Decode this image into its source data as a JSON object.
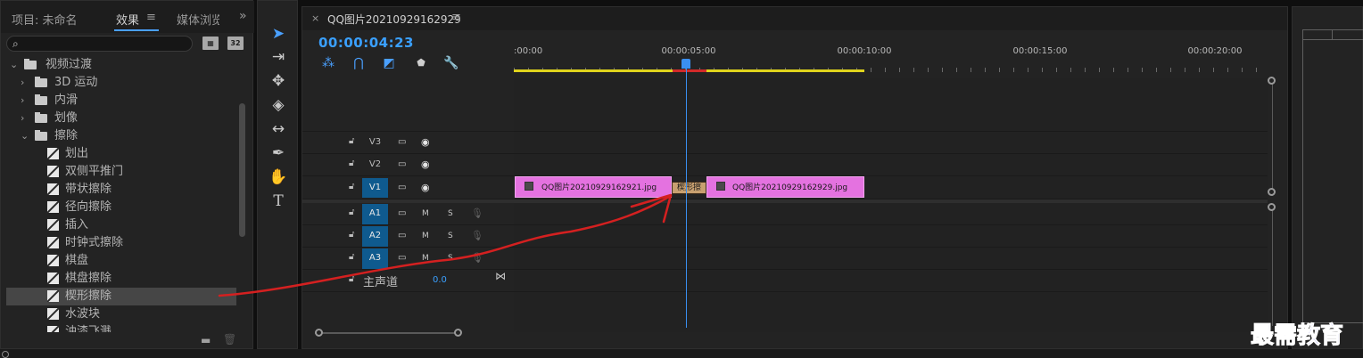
{
  "left_panel": {
    "tabs": [
      {
        "label": "项目: 未命名"
      },
      {
        "label": "效果"
      },
      {
        "label": "媒体浏览"
      }
    ],
    "menu_icon": "≡",
    "overflow_icon": "»",
    "badges": [
      "32",
      "32"
    ],
    "tree": [
      {
        "label": "视频过渡",
        "kind": "folder",
        "expanded": true
      },
      {
        "label": "3D 运动",
        "kind": "folder",
        "expanded": false
      },
      {
        "label": "内滑",
        "kind": "folder",
        "expanded": false
      },
      {
        "label": "划像",
        "kind": "folder",
        "expanded": false
      },
      {
        "label": "擦除",
        "kind": "folder",
        "expanded": true
      },
      {
        "label": "划出",
        "kind": "effect"
      },
      {
        "label": "双侧平推门",
        "kind": "effect"
      },
      {
        "label": "带状擦除",
        "kind": "effect"
      },
      {
        "label": "径向擦除",
        "kind": "effect"
      },
      {
        "label": "插入",
        "kind": "effect"
      },
      {
        "label": "时钟式擦除",
        "kind": "effect"
      },
      {
        "label": "棋盘",
        "kind": "effect"
      },
      {
        "label": "棋盘擦除",
        "kind": "effect"
      },
      {
        "label": "楔形擦除",
        "kind": "effect",
        "selected": true
      },
      {
        "label": "水波块",
        "kind": "effect"
      },
      {
        "label": "油漆飞溅",
        "kind": "effect"
      }
    ]
  },
  "tools": [
    {
      "icon": "selection-tool-icon",
      "glyph": "➤",
      "active": true
    },
    {
      "icon": "track-select-tool-icon",
      "glyph": "⇥"
    },
    {
      "icon": "ripple-edit-tool-icon",
      "glyph": "✥"
    },
    {
      "icon": "razor-tool-icon",
      "glyph": "◈"
    },
    {
      "icon": "slip-tool-icon",
      "glyph": "↔"
    },
    {
      "icon": "pen-tool-icon",
      "glyph": "✒"
    },
    {
      "icon": "hand-tool-icon",
      "glyph": "✋"
    },
    {
      "icon": "type-tool-icon",
      "glyph": "T"
    }
  ],
  "timeline": {
    "sequence_name": "QQ图片20210929162929",
    "close_glyph": "×",
    "menu_glyph": "≡",
    "timecode": "00:00:04:23",
    "ruler_labels": [
      ":00:00",
      "00:00:05:00",
      "00:00:10:00",
      "00:00:15:00",
      "00:00:20:00"
    ],
    "video_tracks": [
      {
        "label": "V3",
        "target": false
      },
      {
        "label": "V2",
        "target": false
      },
      {
        "label": "V1",
        "target": true
      }
    ],
    "audio_tracks": [
      {
        "label": "A1",
        "target": true,
        "m": "M",
        "s": "S"
      },
      {
        "label": "A2",
        "target": true,
        "m": "M",
        "s": "S"
      },
      {
        "label": "A3",
        "target": true,
        "m": "M",
        "s": "S"
      }
    ],
    "clips": [
      {
        "name": "QQ图片20210929162921.jpg",
        "color": "#e472e0"
      },
      {
        "name": "QQ图片20210929162929.jpg",
        "color": "#e472e0"
      }
    ],
    "transition_label": "楔形擦",
    "master": {
      "label": "主声道",
      "value": "0.0"
    }
  },
  "watermark": "最需教育",
  "colors": {
    "accent": "#3aa0ff",
    "clip": "#e472e0",
    "workarea": "#e0d31c",
    "annotation": "#d42020",
    "watermark": "#1b1bd6"
  }
}
